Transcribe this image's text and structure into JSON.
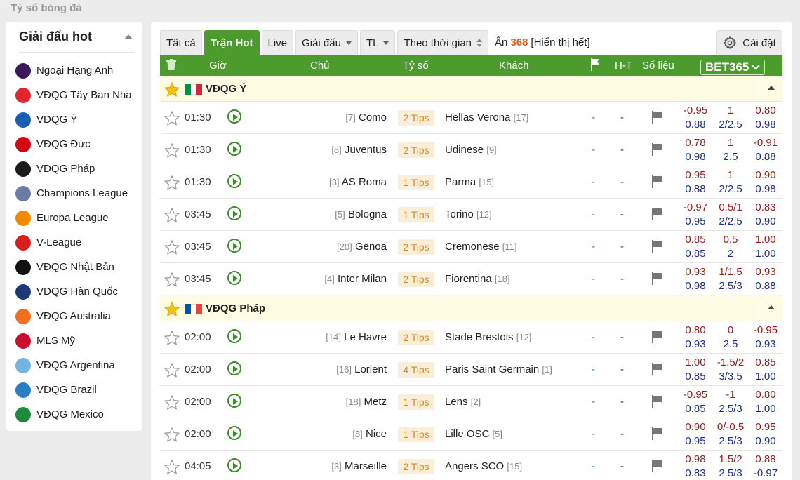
{
  "page_title": "Tỷ số bóng đá",
  "sidebar": {
    "title": "Giải đấu hot",
    "items": [
      {
        "label": "Ngoại Hạng Anh",
        "color": "#3d195b"
      },
      {
        "label": "VĐQG Tây Ban Nha",
        "color": "#e0262f"
      },
      {
        "label": "VĐQG Ý",
        "color": "#1a5fb4"
      },
      {
        "label": "VĐQG Đức",
        "color": "#d20515"
      },
      {
        "label": "VĐQG Pháp",
        "color": "#1b1b1b"
      },
      {
        "label": "Champions League",
        "color": "#6a7ba8"
      },
      {
        "label": "Europa League",
        "color": "#f08a00"
      },
      {
        "label": "V-League",
        "color": "#d6201f"
      },
      {
        "label": "VĐQG Nhật Bản",
        "color": "#111111"
      },
      {
        "label": "VĐQG Hàn Quốc",
        "color": "#1d3a78"
      },
      {
        "label": "VĐQG Australia",
        "color": "#f06e1d"
      },
      {
        "label": "MLS Mỹ",
        "color": "#c8102e"
      },
      {
        "label": "VĐQG Argentina",
        "color": "#75b3e0"
      },
      {
        "label": "VĐQG Brazil",
        "color": "#2a7ec2"
      },
      {
        "label": "VĐQG Mexico",
        "color": "#1f8a3c"
      }
    ]
  },
  "tabs": {
    "all": "Tất cả",
    "hot": "Trận Hot",
    "live": "Live",
    "league": "Giải đấu",
    "tl": "TL",
    "by_time": "Theo thời gian",
    "hidden_prefix": "Ẩn",
    "hidden_count": "368",
    "show_all": "[Hiển thị hết]",
    "settings": "Cài đặt"
  },
  "columns": {
    "time": "Giờ",
    "home": "Chủ",
    "score": "Tỷ số",
    "away": "Khách",
    "ht": "H-T",
    "stats": "Số liệu",
    "bookmaker": "BET365"
  },
  "leagues": [
    {
      "name": "VĐQG Ý",
      "flag": [
        "#009246",
        "#ffffff",
        "#ce2b37"
      ],
      "matches": [
        {
          "time": "01:30",
          "home_rank": "[7]",
          "home": "Como",
          "tips": "2 Tips",
          "away": "Hellas Verona",
          "away_rank": "[17]",
          "score": "-",
          "ht": "-",
          "odds": [
            [
              "-0.95",
              "0.88"
            ],
            [
              "1",
              "2/2.5"
            ],
            [
              "0.80",
              "0.98"
            ]
          ]
        },
        {
          "time": "01:30",
          "home_rank": "[8]",
          "home": "Juventus",
          "tips": "2 Tips",
          "away": "Udinese",
          "away_rank": "[9]",
          "score": "-",
          "ht": "-",
          "odds": [
            [
              "0.78",
              "0.98"
            ],
            [
              "1",
              "2.5"
            ],
            [
              "-0.91",
              "0.88"
            ]
          ]
        },
        {
          "time": "01:30",
          "home_rank": "[3]",
          "home": "AS Roma",
          "tips": "1 Tips",
          "away": "Parma",
          "away_rank": "[15]",
          "score": "-",
          "ht": "-",
          "odds": [
            [
              "0.95",
              "0.88"
            ],
            [
              "1",
              "2/2.5"
            ],
            [
              "0.90",
              "0.98"
            ]
          ]
        },
        {
          "time": "03:45",
          "home_rank": "[5]",
          "home": "Bologna",
          "tips": "1 Tips",
          "away": "Torino",
          "away_rank": "[12]",
          "score": "-",
          "ht": "-",
          "odds": [
            [
              "-0.97",
              "0.95"
            ],
            [
              "0.5/1",
              "2/2.5"
            ],
            [
              "0.83",
              "0.90"
            ]
          ]
        },
        {
          "time": "03:45",
          "home_rank": "[20]",
          "home": "Genoa",
          "tips": "2 Tips",
          "away": "Cremonese",
          "away_rank": "[11]",
          "score": "-",
          "ht": "-",
          "odds": [
            [
              "0.85",
              "0.85"
            ],
            [
              "0.5",
              "2"
            ],
            [
              "1.00",
              "1.00"
            ]
          ]
        },
        {
          "time": "03:45",
          "home_rank": "[4]",
          "home": "Inter Milan",
          "tips": "2 Tips",
          "away": "Fiorentina",
          "away_rank": "[18]",
          "score": "-",
          "ht": "-",
          "odds": [
            [
              "0.93",
              "0.98"
            ],
            [
              "1/1.5",
              "2.5/3"
            ],
            [
              "0.93",
              "0.88"
            ]
          ]
        }
      ]
    },
    {
      "name": "VĐQG Pháp",
      "flag": [
        "#0055a4",
        "#ffffff",
        "#ef4135"
      ],
      "matches": [
        {
          "time": "02:00",
          "home_rank": "[14]",
          "home": "Le Havre",
          "tips": "2 Tips",
          "away": "Stade Brestois",
          "away_rank": "[12]",
          "score": "-",
          "ht": "-",
          "odds": [
            [
              "0.80",
              "0.93"
            ],
            [
              "0",
              "2.5"
            ],
            [
              "-0.95",
              "0.93"
            ]
          ]
        },
        {
          "time": "02:00",
          "home_rank": "[16]",
          "home": "Lorient",
          "tips": "4 Tips",
          "away": "Paris Saint Germain",
          "away_rank": "[1]",
          "score": "-",
          "ht": "-",
          "odds": [
            [
              "1.00",
              "0.85"
            ],
            [
              "-1.5/2",
              "3/3.5"
            ],
            [
              "0.85",
              "1.00"
            ]
          ]
        },
        {
          "time": "02:00",
          "home_rank": "[18]",
          "home": "Metz",
          "tips": "1 Tips",
          "away": "Lens",
          "away_rank": "[2]",
          "score": "-",
          "ht": "-",
          "odds": [
            [
              "-0.95",
              "0.85"
            ],
            [
              "-1",
              "2.5/3"
            ],
            [
              "0.80",
              "1.00"
            ]
          ]
        },
        {
          "time": "02:00",
          "home_rank": "[8]",
          "home": "Nice",
          "tips": "1 Tips",
          "away": "Lille OSC",
          "away_rank": "[5]",
          "score": "-",
          "ht": "-",
          "odds": [
            [
              "0.90",
              "0.95"
            ],
            [
              "0/-0.5",
              "2.5/3"
            ],
            [
              "0.95",
              "0.90"
            ]
          ]
        },
        {
          "time": "04:05",
          "home_rank": "[3]",
          "home": "Marseille",
          "tips": "2 Tips",
          "away": "Angers SCO",
          "away_rank": "[15]",
          "score": "-",
          "ht": "-",
          "odds": [
            [
              "0.98",
              "0.83"
            ],
            [
              "1.5/2",
              "2.5/3"
            ],
            [
              "0.88",
              "-0.97"
            ]
          ]
        }
      ]
    }
  ]
}
